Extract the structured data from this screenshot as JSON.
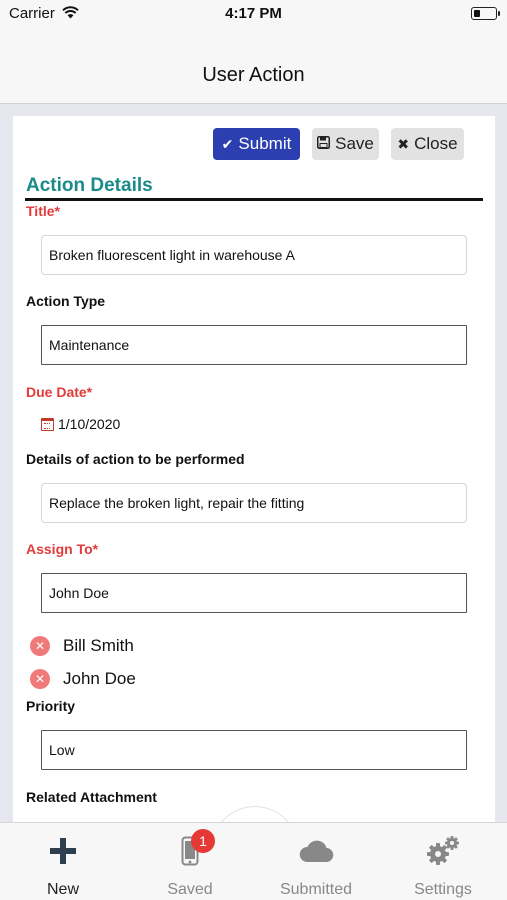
{
  "status_bar": {
    "carrier": "Carrier",
    "time": "4:17 PM"
  },
  "nav": {
    "title": "User Action"
  },
  "toolbar": {
    "submit_label": "Submit",
    "save_label": "Save",
    "close_label": "Close"
  },
  "section": {
    "title": "Action Details"
  },
  "form": {
    "title": {
      "label": "Title*",
      "value": "Broken fluorescent light in warehouse A"
    },
    "action_type": {
      "label": "Action Type",
      "value": "Maintenance"
    },
    "due_date": {
      "label": "Due Date*",
      "value": "1/10/2020"
    },
    "details": {
      "label": "Details of action to be performed",
      "value": "Replace the broken light, repair the fitting"
    },
    "assign_to": {
      "label": "Assign To*",
      "value": "John Doe"
    },
    "assignees": [
      "Bill Smith",
      "John Doe"
    ],
    "priority": {
      "label": "Priority",
      "value": "Low"
    },
    "attachment": {
      "label": "Related Attachment"
    }
  },
  "tabs": [
    {
      "label": "New",
      "icon": "plus-icon",
      "active": true
    },
    {
      "label": "Saved",
      "icon": "phone-icon",
      "badge": "1"
    },
    {
      "label": "Submitted",
      "icon": "cloud-icon"
    },
    {
      "label": "Settings",
      "icon": "gears-icon"
    }
  ],
  "colors": {
    "accent": "#2b3fb0",
    "section_title": "#1a8a8a",
    "required": "#e23b3b",
    "badge": "#e53935"
  }
}
